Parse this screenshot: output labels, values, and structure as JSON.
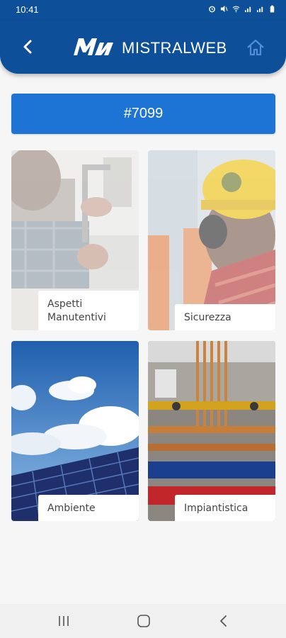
{
  "status_bar": {
    "time": "10:41",
    "icons": [
      "image-icon",
      "alarm-icon",
      "mute-icon",
      "wifi-icon",
      "signal-icon",
      "signal-icon",
      "battery-icon"
    ]
  },
  "app_bar": {
    "brand": "MISTRALWEB",
    "background": "#0d4f98",
    "back_icon": "chevron-left-icon",
    "home_icon": "home-icon"
  },
  "ticket": {
    "label": "#7099",
    "color": "#1e74d4"
  },
  "categories": [
    {
      "label": "Aspetti\nManutentivi",
      "image": "technician-tap-photo"
    },
    {
      "label": "Sicurezza",
      "image": "hardhat-worker-photo"
    },
    {
      "label": "Ambiente",
      "image": "solar-panels-sky-photo"
    },
    {
      "label": "Impiantistica",
      "image": "pipes-installation-photo"
    }
  ],
  "nav_bar": {
    "icons": [
      "recent-apps-icon",
      "home-circle-icon",
      "back-icon"
    ]
  }
}
